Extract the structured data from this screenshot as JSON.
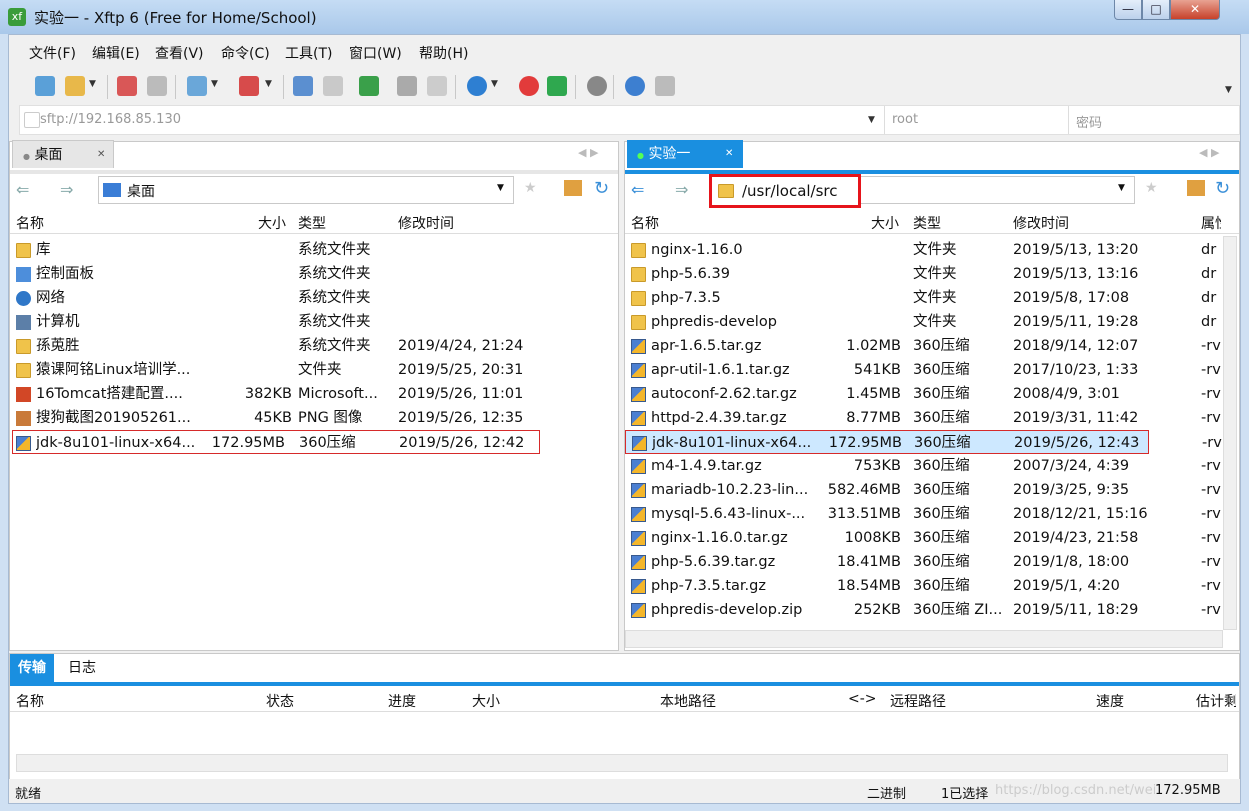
{
  "window": {
    "title": "实验一 - Xftp 6 (Free for Home/School)",
    "app_icon_text": "xf",
    "min": "—",
    "max": "□",
    "close": "✕"
  },
  "menu": [
    "文件(F)",
    "编辑(E)",
    "查看(V)",
    "命令(C)",
    "工具(T)",
    "窗口(W)",
    "帮助(H)"
  ],
  "address": {
    "value": "sftp://192.168.85.130",
    "user_placeholder": "root",
    "password_placeholder": "密码"
  },
  "left_pane": {
    "tab": "桌面",
    "tab_close": "✕",
    "path": "桌面",
    "columns": [
      "名称",
      "大小",
      "类型",
      "修改时间"
    ],
    "rows": [
      {
        "name": "库",
        "size": "",
        "type": "系统文件夹",
        "mtime": "",
        "icon": "library-icon"
      },
      {
        "name": "控制面板",
        "size": "",
        "type": "系统文件夹",
        "mtime": "",
        "icon": "control-panel-icon"
      },
      {
        "name": "网络",
        "size": "",
        "type": "系统文件夹",
        "mtime": "",
        "icon": "network-icon"
      },
      {
        "name": "计算机",
        "size": "",
        "type": "系统文件夹",
        "mtime": "",
        "icon": "computer-icon"
      },
      {
        "name": "孫莵胜",
        "size": "",
        "type": "系统文件夹",
        "mtime": "2019/4/24, 21:24",
        "icon": "user-icon"
      },
      {
        "name": "猿课阿铭Linux培训学...",
        "size": "",
        "type": "文件夹",
        "mtime": "2019/5/25, 20:31",
        "icon": "folder-icon"
      },
      {
        "name": "16Tomcat搭建配置....",
        "size": "382KB",
        "type": "Microsoft...",
        "mtime": "2019/5/26, 11:01",
        "icon": "ppt-icon"
      },
      {
        "name": "搜狗截图201905261...",
        "size": "45KB",
        "type": "PNG 图像",
        "mtime": "2019/5/26, 12:35",
        "icon": "image-icon"
      },
      {
        "name": "jdk-8u101-linux-x64...",
        "size": "172.95MB",
        "type": "360压缩",
        "mtime": "2019/5/26, 12:42",
        "icon": "archive-icon"
      }
    ]
  },
  "right_pane": {
    "tab": "实验一",
    "tab_close": "✕",
    "path": "/usr/local/src",
    "columns": [
      "名称",
      "大小",
      "类型",
      "修改时间",
      "属性"
    ],
    "rows": [
      {
        "name": "nginx-1.16.0",
        "size": "",
        "type": "文件夹",
        "mtime": "2019/5/13, 13:20",
        "attr": "dr",
        "icon": "folder-icon"
      },
      {
        "name": "php-5.6.39",
        "size": "",
        "type": "文件夹",
        "mtime": "2019/5/13, 13:16",
        "attr": "dr",
        "icon": "folder-icon"
      },
      {
        "name": "php-7.3.5",
        "size": "",
        "type": "文件夹",
        "mtime": "2019/5/8, 17:08",
        "attr": "dr",
        "icon": "folder-icon"
      },
      {
        "name": "phpredis-develop",
        "size": "",
        "type": "文件夹",
        "mtime": "2019/5/11, 19:28",
        "attr": "dr",
        "icon": "folder-icon"
      },
      {
        "name": "apr-1.6.5.tar.gz",
        "size": "1.02MB",
        "type": "360压缩",
        "mtime": "2018/9/14, 12:07",
        "attr": "-rv",
        "icon": "archive-icon"
      },
      {
        "name": "apr-util-1.6.1.tar.gz",
        "size": "541KB",
        "type": "360压缩",
        "mtime": "2017/10/23, 1:33",
        "attr": "-rv",
        "icon": "archive-icon"
      },
      {
        "name": "autoconf-2.62.tar.gz",
        "size": "1.45MB",
        "type": "360压缩",
        "mtime": "2008/4/9, 3:01",
        "attr": "-rv",
        "icon": "archive-icon"
      },
      {
        "name": "httpd-2.4.39.tar.gz",
        "size": "8.77MB",
        "type": "360压缩",
        "mtime": "2019/3/31, 11:42",
        "attr": "-rv",
        "icon": "archive-icon"
      },
      {
        "name": "jdk-8u101-linux-x64...",
        "size": "172.95MB",
        "type": "360压缩",
        "mtime": "2019/5/26, 12:43",
        "attr": "-rv",
        "icon": "archive-icon"
      },
      {
        "name": "m4-1.4.9.tar.gz",
        "size": "753KB",
        "type": "360压缩",
        "mtime": "2007/3/24, 4:39",
        "attr": "-rv",
        "icon": "archive-icon"
      },
      {
        "name": "mariadb-10.2.23-lin...",
        "size": "582.46MB",
        "type": "360压缩",
        "mtime": "2019/3/25, 9:35",
        "attr": "-rv",
        "icon": "archive-icon"
      },
      {
        "name": "mysql-5.6.43-linux-...",
        "size": "313.51MB",
        "type": "360压缩",
        "mtime": "2018/12/21, 15:16",
        "attr": "-rv",
        "icon": "archive-icon"
      },
      {
        "name": "nginx-1.16.0.tar.gz",
        "size": "1008KB",
        "type": "360压缩",
        "mtime": "2019/4/23, 21:58",
        "attr": "-rv",
        "icon": "archive-icon"
      },
      {
        "name": "php-5.6.39.tar.gz",
        "size": "18.41MB",
        "type": "360压缩",
        "mtime": "2019/1/8, 18:00",
        "attr": "-rv",
        "icon": "archive-icon"
      },
      {
        "name": "php-7.3.5.tar.gz",
        "size": "18.54MB",
        "type": "360压缩",
        "mtime": "2019/5/1, 4:20",
        "attr": "-rv",
        "icon": "archive-icon"
      },
      {
        "name": "phpredis-develop.zip",
        "size": "252KB",
        "type": "360压缩 ZI...",
        "mtime": "2019/5/11, 18:29",
        "attr": "-rv",
        "icon": "archive-icon"
      }
    ]
  },
  "bottom": {
    "tabs": [
      "传输",
      "日志"
    ],
    "columns": [
      "名称",
      "状态",
      "进度",
      "大小",
      "本地路径",
      "<->",
      "远程路径",
      "速度",
      "估计剩"
    ]
  },
  "status": {
    "left": "就绪",
    "mode": "二进制",
    "selected": "1已选择",
    "size": "172.95MB",
    "watermark": "https://blog.csdn.net/weixin_42..."
  },
  "colors": {
    "accent": "#1a8fe0",
    "highlight_red": "#e6141b",
    "row_selected": "#cde8ff"
  }
}
